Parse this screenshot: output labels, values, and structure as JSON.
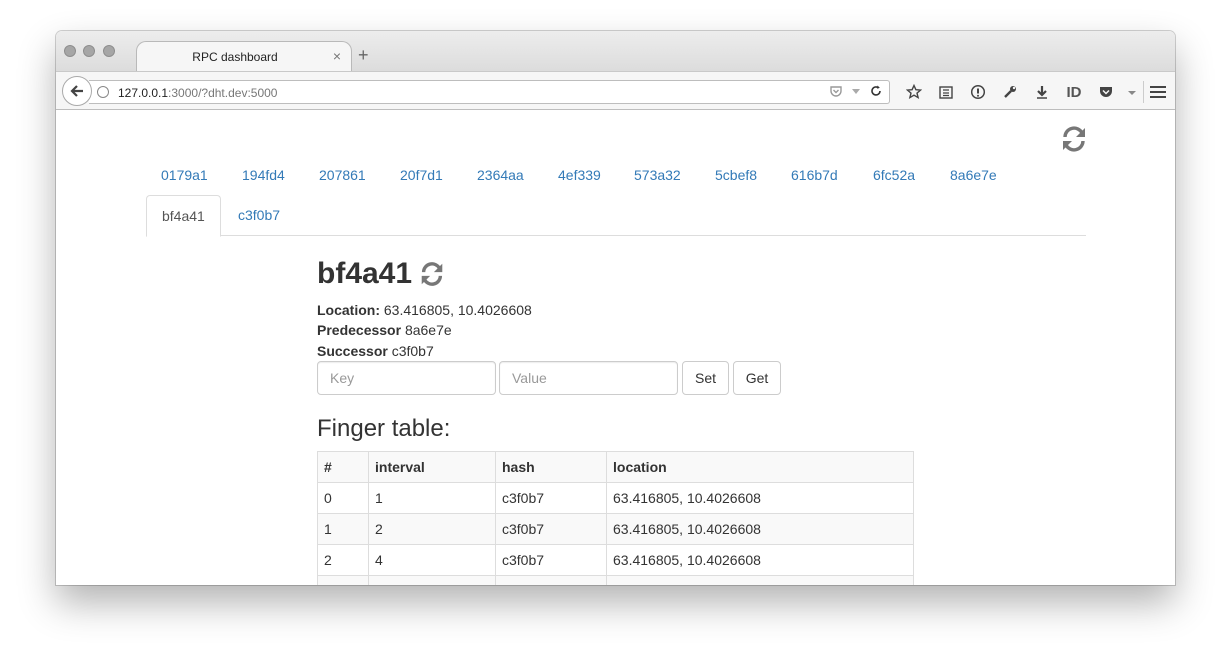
{
  "browser": {
    "tab_title": "RPC dashboard",
    "tab_close": "×",
    "new_tab": "+",
    "url_host": "127.0.0.1",
    "url_rest": ":3000/?dht.dev:5000",
    "toolbar_id_label": "ID"
  },
  "nodes": [
    "0179a1",
    "194fd4",
    "207861",
    "20f7d1",
    "2364aa",
    "4ef339",
    "573a32",
    "5cbef8",
    "616b7d",
    "6fc52a",
    "8a6e7e",
    "bf4a41",
    "c3f0b7"
  ],
  "active_node": "bf4a41",
  "detail": {
    "title": "bf4a41",
    "location_label": "Location:",
    "location_value": "63.416805, 10.4026608",
    "predecessor_label": "Predecessor",
    "predecessor_value": "8a6e7e",
    "successor_label": "Successor",
    "successor_value": "c3f0b7",
    "key_placeholder": "Key",
    "value_placeholder": "Value",
    "set_label": "Set",
    "get_label": "Get"
  },
  "finger_table": {
    "title": "Finger table:",
    "headers": [
      "#",
      "interval",
      "hash",
      "location"
    ],
    "rows": [
      [
        "0",
        "1",
        "c3f0b7",
        "63.416805, 10.4026608"
      ],
      [
        "1",
        "2",
        "c3f0b7",
        "63.416805, 10.4026608"
      ],
      [
        "2",
        "4",
        "c3f0b7",
        "63.416805, 10.4026608"
      ]
    ]
  },
  "colors": {
    "link": "#337ab7",
    "text": "#333333",
    "icon_gray": "#777777"
  },
  "icons": {
    "refresh": "refresh-icon",
    "back": "back-arrow-icon"
  }
}
